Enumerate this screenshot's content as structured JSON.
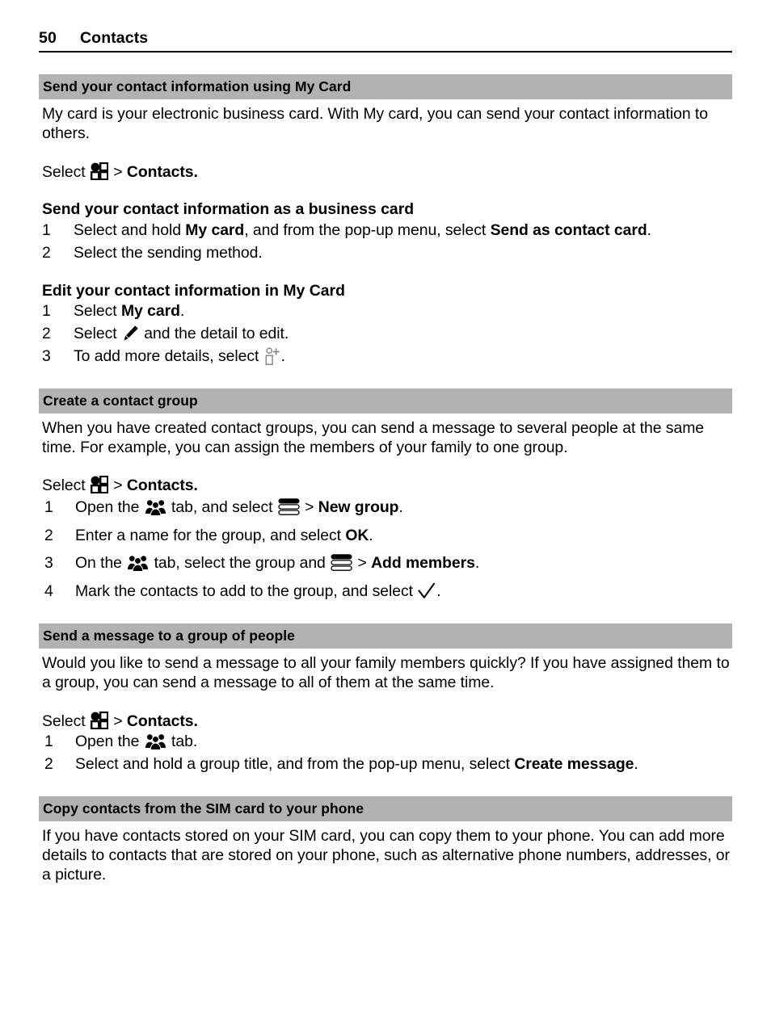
{
  "header": {
    "page_number": "50",
    "chapter": "Contacts"
  },
  "sections": [
    {
      "id": "my-card",
      "title": "Send your contact information using My Card",
      "intro": "My card is your electronic business card. With My card, you can send your contact information to others.",
      "select_prefix": "Select",
      "select_separator": ">",
      "select_target": "Contacts.",
      "sub_sections": [
        {
          "heading": "Send your contact information as a business card",
          "steps": [
            {
              "num": "1",
              "parts": [
                {
                  "t": "Select and hold ",
                  "b": false
                },
                {
                  "t": "My card",
                  "b": true
                },
                {
                  "t": ", and from the pop-up menu, select ",
                  "b": false
                },
                {
                  "t": "Send as contact card",
                  "b": true
                },
                {
                  "t": ".",
                  "b": false
                }
              ]
            },
            {
              "num": "2",
              "parts": [
                {
                  "t": "Select the sending method.",
                  "b": false
                }
              ]
            }
          ]
        },
        {
          "heading": "Edit your contact information in My Card",
          "steps": [
            {
              "num": "1",
              "parts": [
                {
                  "t": "Select ",
                  "b": false
                },
                {
                  "t": "My card",
                  "b": true
                },
                {
                  "t": ".",
                  "b": false
                }
              ]
            },
            {
              "num": "2",
              "parts": [
                {
                  "t": "Select ",
                  "b": false
                },
                {
                  "icon": "pencil-icon"
                },
                {
                  "t": " and the detail to edit.",
                  "b": false
                }
              ]
            },
            {
              "num": "3",
              "parts": [
                {
                  "t": "To add more details, select ",
                  "b": false
                },
                {
                  "icon": "add-detail-icon"
                },
                {
                  "t": ".",
                  "b": false
                }
              ]
            }
          ]
        }
      ]
    },
    {
      "id": "create-group",
      "title": "Create a contact group",
      "intro": "When you have created contact groups, you can send a message to several people at the same time. For example, you can assign the members of your family to one group.",
      "select_prefix": "Select",
      "select_separator": ">",
      "select_target": "Contacts.",
      "steps": [
        {
          "num": "1",
          "parts": [
            {
              "t": "Open the ",
              "b": false
            },
            {
              "icon": "groups-tab-icon"
            },
            {
              "t": " tab, and select ",
              "b": false
            },
            {
              "icon": "options-icon"
            },
            {
              "t": " > ",
              "b": false
            },
            {
              "t": "New group",
              "b": true
            },
            {
              "t": ".",
              "b": false
            }
          ]
        },
        {
          "num": "2",
          "parts": [
            {
              "t": "Enter a name for the group, and select ",
              "b": false
            },
            {
              "t": "OK",
              "b": true
            },
            {
              "t": ".",
              "b": false
            }
          ]
        },
        {
          "num": "3",
          "parts": [
            {
              "t": "On the ",
              "b": false
            },
            {
              "icon": "groups-tab-icon"
            },
            {
              "t": " tab, select the group and ",
              "b": false
            },
            {
              "icon": "options-icon"
            },
            {
              "t": " > ",
              "b": false
            },
            {
              "t": "Add members",
              "b": true
            },
            {
              "t": ".",
              "b": false
            }
          ]
        },
        {
          "num": "4",
          "parts": [
            {
              "t": "Mark the contacts to add to the group, and select ",
              "b": false
            },
            {
              "icon": "check-icon"
            },
            {
              "t": ".",
              "b": false
            }
          ]
        }
      ]
    },
    {
      "id": "group-message",
      "title": "Send a message to a group of people",
      "intro": "Would you like to send a message to all your family members quickly? If you have assigned them to a group, you can send a message to all of them at the same time.",
      "select_prefix": "Select",
      "select_separator": ">",
      "select_target": "Contacts.",
      "steps": [
        {
          "num": "1",
          "parts": [
            {
              "t": "Open the ",
              "b": false
            },
            {
              "icon": "groups-tab-icon"
            },
            {
              "t": " tab.",
              "b": false
            }
          ]
        },
        {
          "num": "2",
          "parts": [
            {
              "t": "Select and hold a group title, and from the pop-up menu, select ",
              "b": false
            },
            {
              "t": "Create message",
              "b": true
            },
            {
              "t": ".",
              "b": false
            }
          ]
        }
      ]
    },
    {
      "id": "copy-sim",
      "title": "Copy contacts from the SIM card to your phone",
      "intro": "If you have contacts stored on your SIM card, you can copy them to your phone. You can add more details to contacts that are stored on your phone, such as alternative phone numbers, addresses, or a picture."
    }
  ],
  "icons": {
    "menu-icon": "app-menu-grid",
    "pencil-icon": "edit-pencil",
    "add-detail-icon": "add-contact-detail",
    "groups-tab-icon": "contact-groups-tab",
    "options-icon": "options-stacked-bars",
    "check-icon": "confirm-checkmark"
  },
  "colors": {
    "section_bar": "#b2b2b2",
    "text": "#000000",
    "page_background": "#ffffff"
  }
}
